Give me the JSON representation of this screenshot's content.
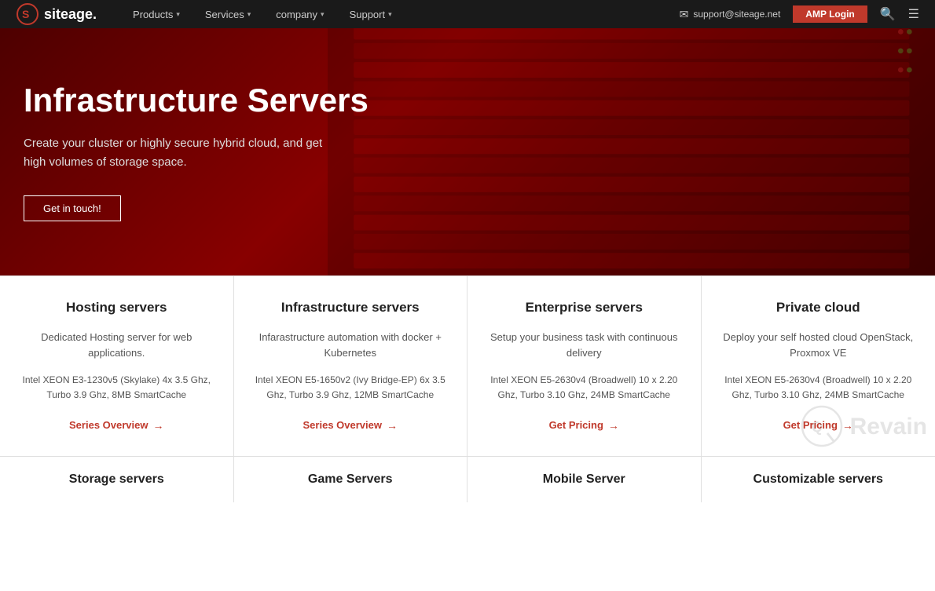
{
  "nav": {
    "logo_text": "siteage.",
    "links": [
      {
        "label": "Products",
        "has_dropdown": true
      },
      {
        "label": "Services",
        "has_dropdown": true
      },
      {
        "label": "company",
        "has_dropdown": true
      },
      {
        "label": "Support",
        "has_dropdown": true
      }
    ],
    "email": "support@siteage.net",
    "amp_btn_label": "AMP Login"
  },
  "hero": {
    "title": "Infrastructure Servers",
    "subtitle_line1": "Create your cluster or highly secure hybrid cloud, and get",
    "subtitle_line2": "high volumes of storage space.",
    "btn_label": "Get in touch!"
  },
  "cards": [
    {
      "title": "Hosting servers",
      "desc": "Dedicated Hosting server for web applications.",
      "spec": "Intel XEON E3-1230v5 (Skylake)  4x 3.5 Ghz, Turbo 3.9 Ghz, 8MB SmartCache",
      "link_label": "Series Overview",
      "link_type": "overview"
    },
    {
      "title": "Infrastructure servers",
      "desc": "Infarastructure automation with docker + Kubernetes",
      "spec": "Intel XEON E5-1650v2 (Ivy Bridge-EP) 6x 3.5 Ghz, Turbo 3.9 Ghz, 12MB SmartCache",
      "link_label": "Series Overview",
      "link_type": "overview"
    },
    {
      "title": "Enterprise servers",
      "desc": "Setup your business task with continuous delivery",
      "spec": "Intel XEON E5-2630v4 (Broadwell) 10 x 2.20 Ghz, Turbo 3.10 Ghz, 24MB SmartCache",
      "link_label": "Get Pricing",
      "link_type": "pricing"
    },
    {
      "title": "Private cloud",
      "desc": "Deploy your self hosted cloud OpenStack, Proxmox VE",
      "spec": "Intel XEON E5-2630v4 (Broadwell) 10 x 2.20 Ghz, Turbo 3.10 Ghz, 24MB SmartCache",
      "link_label": "Get Pricing",
      "link_type": "pricing"
    }
  ],
  "bottom_cards": [
    {
      "title": "Storage servers"
    },
    {
      "title": "Game Servers"
    },
    {
      "title": "Mobile Server"
    },
    {
      "title": "Customizable servers"
    }
  ],
  "revain": {
    "text": "Revain"
  }
}
